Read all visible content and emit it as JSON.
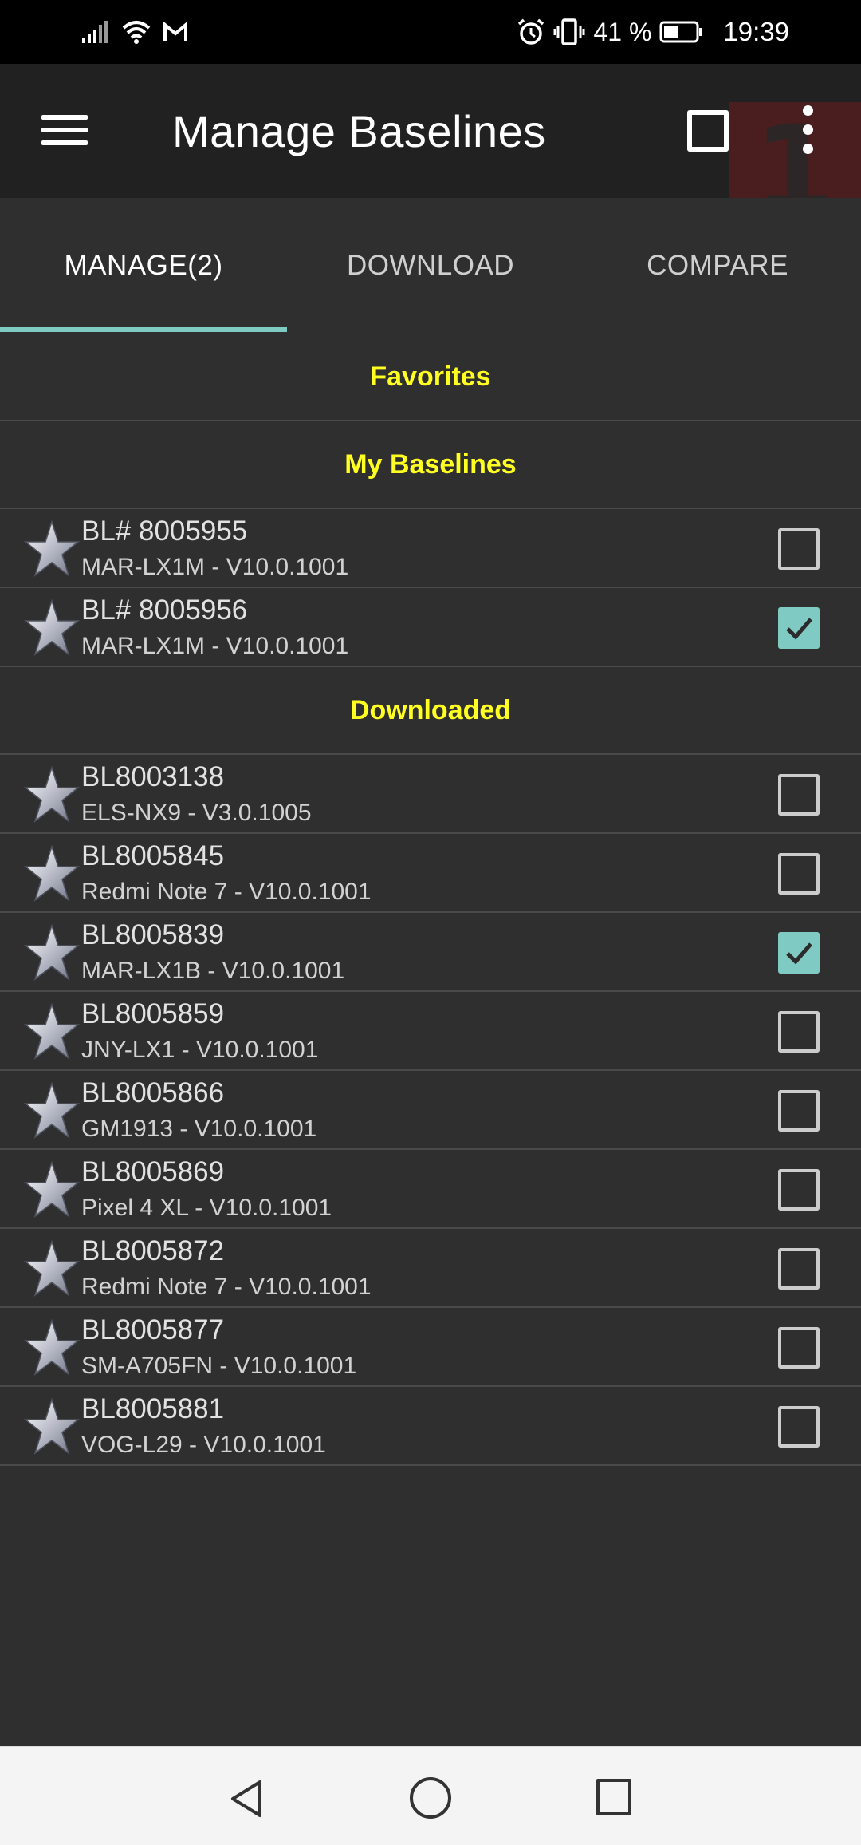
{
  "status_bar": {
    "battery_percent": "41 %",
    "time": "19:39",
    "icons": [
      "signal-icon",
      "wifi-icon",
      "gmail-icon",
      "alarm-icon",
      "vibrate-icon",
      "battery-icon"
    ]
  },
  "app_bar": {
    "title": "Manage Baselines",
    "badge": "1",
    "icons": [
      "menu-icon",
      "select-all-checkbox-icon",
      "more-vert-icon"
    ]
  },
  "tabs": [
    {
      "label": "MANAGE(2)",
      "active": true
    },
    {
      "label": "DOWNLOAD",
      "active": false
    },
    {
      "label": "COMPARE",
      "active": false
    }
  ],
  "sections": {
    "favorites": "Favorites",
    "my_baselines": "My Baselines",
    "downloaded": "Downloaded"
  },
  "my_baselines": [
    {
      "title": "BL# 8005955",
      "subtitle": "MAR-LX1M - V10.0.1001",
      "checked": false
    },
    {
      "title": "BL# 8005956",
      "subtitle": "MAR-LX1M - V10.0.1001",
      "checked": true
    }
  ],
  "downloaded": [
    {
      "title": "BL8003138",
      "subtitle": "ELS-NX9 - V3.0.1005",
      "checked": false
    },
    {
      "title": "BL8005845",
      "subtitle": "Redmi Note 7 - V10.0.1001",
      "checked": false
    },
    {
      "title": "BL8005839",
      "subtitle": "MAR-LX1B - V10.0.1001",
      "checked": true
    },
    {
      "title": "BL8005859",
      "subtitle": "JNY-LX1 - V10.0.1001",
      "checked": false
    },
    {
      "title": "BL8005866",
      "subtitle": "GM1913 - V10.0.1001",
      "checked": false
    },
    {
      "title": "BL8005869",
      "subtitle": "Pixel 4 XL - V10.0.1001",
      "checked": false
    },
    {
      "title": "BL8005872",
      "subtitle": "Redmi Note 7 - V10.0.1001",
      "checked": false
    },
    {
      "title": "BL8005877",
      "subtitle": "SM-A705FN - V10.0.1001",
      "checked": false
    },
    {
      "title": "BL8005881",
      "subtitle": "VOG-L29 - V10.0.1001",
      "checked": false
    }
  ],
  "colors": {
    "accent": "#7fcbc4",
    "section_header": "#ffff22",
    "background": "#2f2f2f",
    "app_bar": "#212121"
  },
  "nav_bar": {
    "icons": [
      "back-icon",
      "home-icon",
      "recents-icon"
    ]
  }
}
